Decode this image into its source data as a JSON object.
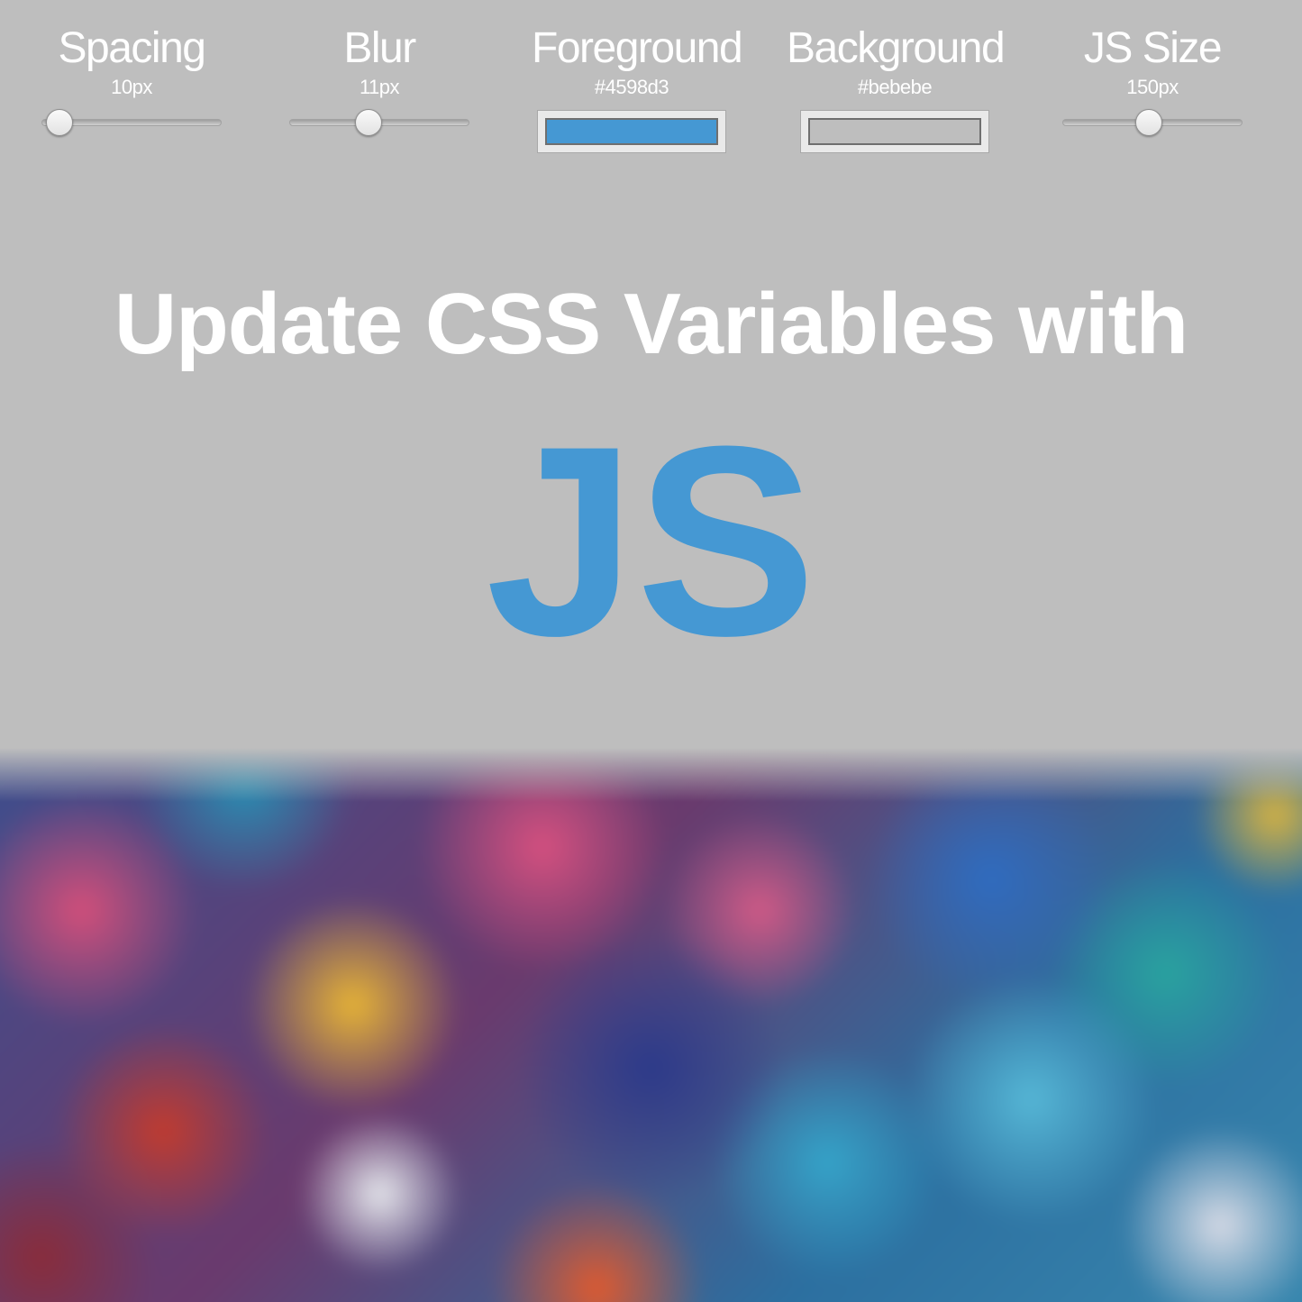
{
  "controls": {
    "spacing": {
      "label": "Spacing",
      "value": "10px",
      "level": 0.1
    },
    "blur": {
      "label": "Blur",
      "value": "11px",
      "level": 0.44
    },
    "foreground": {
      "label": "Foreground",
      "value": "#4598d3",
      "color": "#4598d3"
    },
    "background": {
      "label": "Background",
      "value": "#bebebe",
      "color": "#bebebe"
    },
    "js_size": {
      "label": "JS Size",
      "value": "150px",
      "level": 0.48
    }
  },
  "headline": {
    "text": "Update CSS Variables with",
    "accent_text": "JS"
  },
  "image": {
    "description_icon": "blurred-artwork-image"
  }
}
